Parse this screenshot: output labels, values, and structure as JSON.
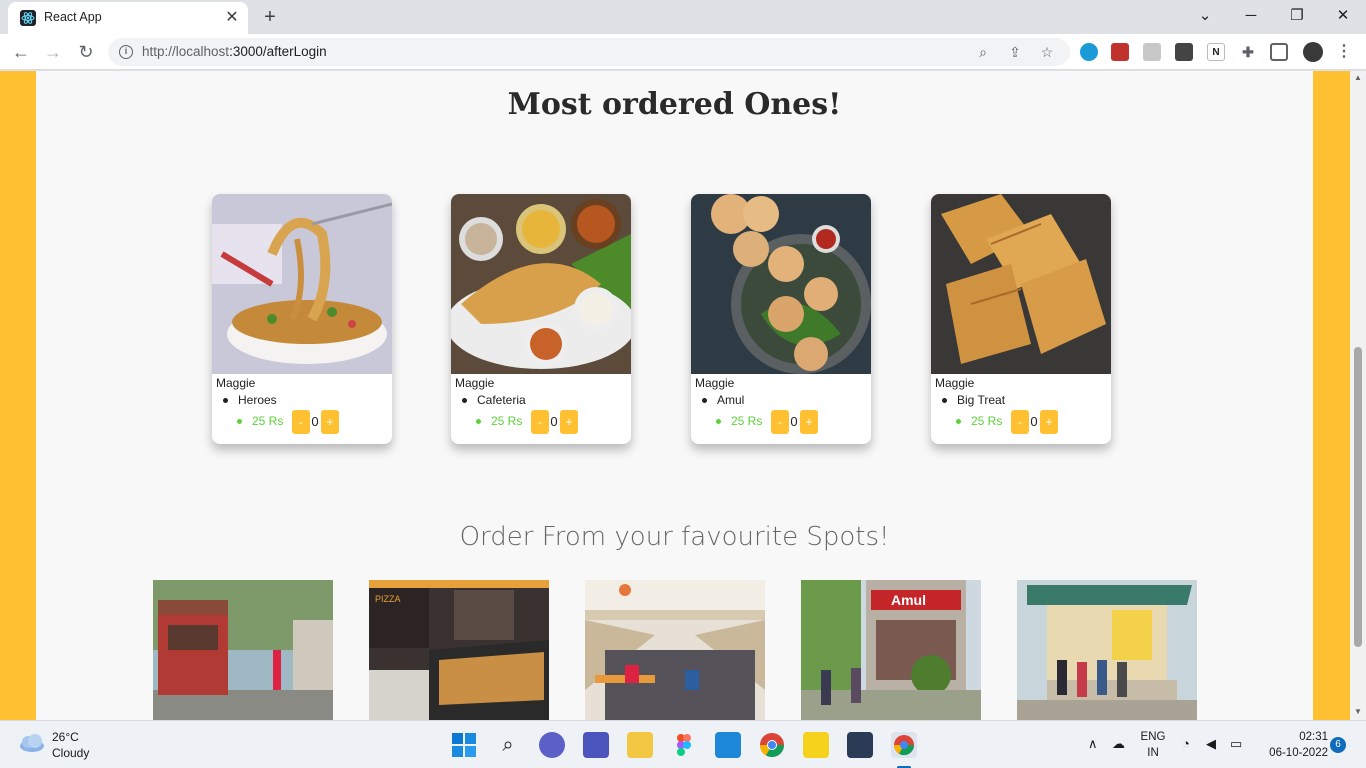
{
  "browser": {
    "tab_title": "React App",
    "url_host": "http://localhost",
    "url_path": ":3000/afterLogin",
    "extensions": [
      "grammar-ext-icon",
      "adblock-icon",
      "reader-icon",
      "pocket-icon",
      "notion-icon",
      "puzzle-icon",
      "sidebar-icon",
      "profile-avatar"
    ]
  },
  "page": {
    "section_title": "Most ordered Ones!",
    "items": [
      {
        "name": "Maggie",
        "spot": "Heroes",
        "price": "25 Rs",
        "minus": "-",
        "qty": "0",
        "plus": "+"
      },
      {
        "name": "Maggie",
        "spot": "Cafeteria",
        "price": "25 Rs",
        "minus": "-",
        "qty": "0",
        "plus": "+"
      },
      {
        "name": "Maggie",
        "spot": "Amul",
        "price": "25 Rs",
        "minus": "-",
        "qty": "0",
        "plus": "+"
      },
      {
        "name": "Maggie",
        "spot": "Big Treat",
        "price": "25 Rs",
        "minus": "-",
        "qty": "0",
        "plus": "+"
      }
    ],
    "spots_title": "Order From your favourite Spots!",
    "spot_signs": [
      "PIZZA",
      "Amul"
    ]
  },
  "taskbar": {
    "temperature": "26°C",
    "condition": "Cloudy",
    "lang_top": "ENG",
    "lang_bottom": "IN",
    "time": "02:31",
    "date": "06-10-2022",
    "notifications": "6"
  },
  "colors": {
    "accent": "#ffc132",
    "price_green": "#5fd13a",
    "page_bg": "#f8f8f8"
  }
}
